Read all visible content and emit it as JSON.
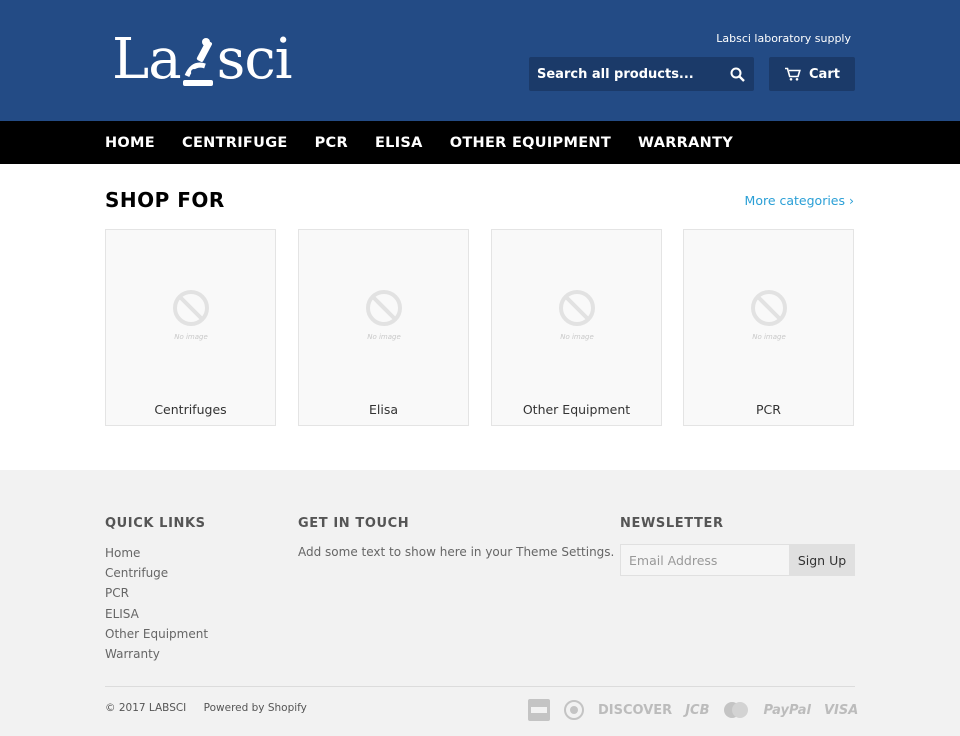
{
  "header": {
    "logo_text": "Labsci",
    "tagline": "Labsci laboratory supply",
    "search_placeholder": "Search all products...",
    "cart_label": "Cart",
    "colors": {
      "header_bg": "#234b85",
      "search_bg": "#1b3a69",
      "nav_bg": "#000000"
    }
  },
  "nav": {
    "items": [
      "HOME",
      "CENTRIFUGE",
      "PCR",
      "ELISA",
      "OTHER EQUIPMENT",
      "WARRANTY"
    ]
  },
  "main": {
    "title": "SHOP FOR",
    "more_link": "More categories ›",
    "cards": [
      {
        "label": "Centrifuges",
        "image_text": "No image"
      },
      {
        "label": "Elisa",
        "image_text": "No image"
      },
      {
        "label": "Other Equipment",
        "image_text": "No image"
      },
      {
        "label": "PCR",
        "image_text": "No image"
      }
    ]
  },
  "footer": {
    "quick_links_title": "QUICK LINKS",
    "quick_links": [
      "Home",
      "Centrifuge",
      "PCR",
      "ELISA",
      "Other Equipment",
      "Warranty"
    ],
    "contact_title": "GET IN TOUCH",
    "contact_text": "Add some text to show here in your Theme Settings.",
    "newsletter_title": "NEWSLETTER",
    "newsletter_placeholder": "Email Address",
    "signup_label": "Sign Up",
    "copyright": "© 2017 LABSCI",
    "powered_by": "Powered by Shopify",
    "payments": [
      "american-express-icon",
      "diners-club-icon",
      "DISCOVER",
      "JCB",
      "master-icon",
      "PayPal",
      "VISA"
    ]
  }
}
